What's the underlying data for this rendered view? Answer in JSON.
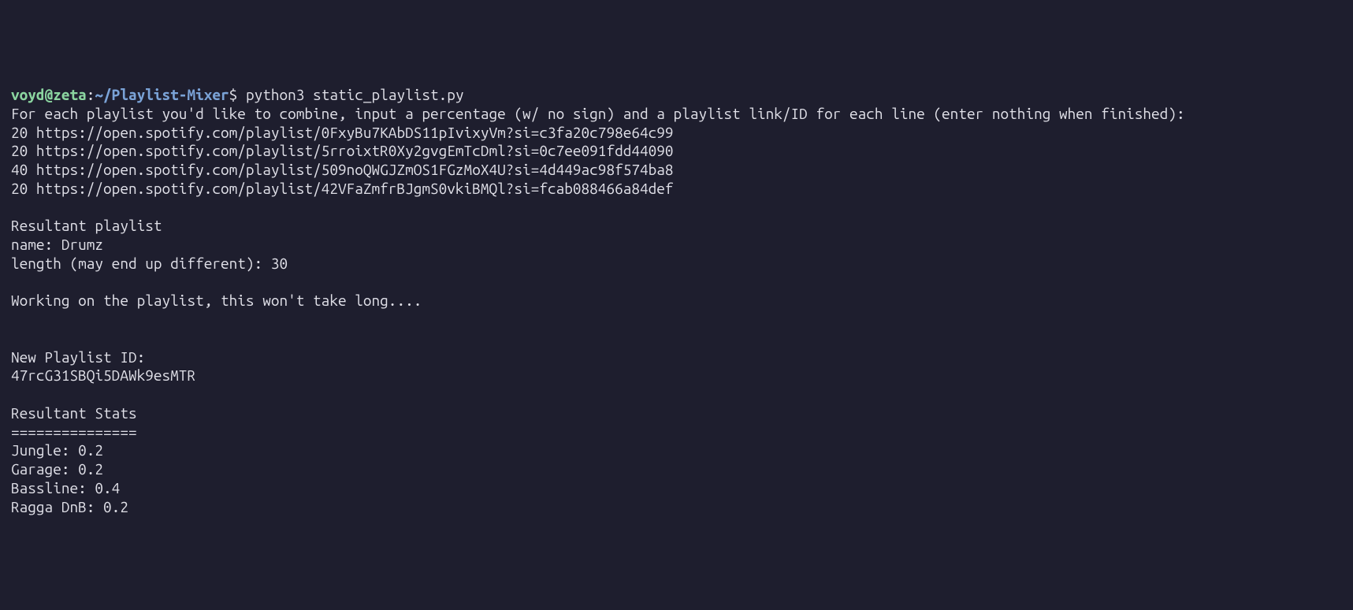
{
  "prompt": {
    "user": "voyd",
    "at": "@",
    "host": "zeta",
    "colon": ":",
    "path": "~/Playlist-Mixer",
    "dollar": "$",
    "command": "python3 static_playlist.py"
  },
  "output": {
    "instruction": "For each playlist you'd like to combine, input a percentage (w/ no sign) and a playlist link/ID for each line (enter nothing when finished):",
    "inputs": [
      "20 https://open.spotify.com/playlist/0FxyBu7KAbDS11pIvixyVm?si=c3fa20c798e64c99",
      "20 https://open.spotify.com/playlist/5rroixtR0Xy2gvgEmTcDml?si=0c7ee091fdd44090",
      "40 https://open.spotify.com/playlist/509noQWGJZmOS1FGzMoX4U?si=4d449ac98f574ba8",
      "20 https://open.spotify.com/playlist/42VFaZmfrBJgmS0vkiBMQl?si=fcab088466a84def"
    ],
    "blank1": "",
    "resultant_header": "Resultant playlist",
    "name_line": "name: Drumz",
    "length_line": "length (may end up different): 30",
    "blank2": "",
    "working": "Working on the playlist, this won't take long....",
    "blank3": "",
    "blank4": "",
    "new_id_label": "New Playlist ID:",
    "new_id": "47rcG31SBQi5DAWk9esMTR",
    "blank5": "",
    "stats_header": "Resultant Stats",
    "stats_divider": "===============",
    "stats": [
      "Jungle: 0.2",
      "Garage: 0.2",
      "Bassline: 0.4",
      "Ragga DnB: 0.2"
    ]
  }
}
